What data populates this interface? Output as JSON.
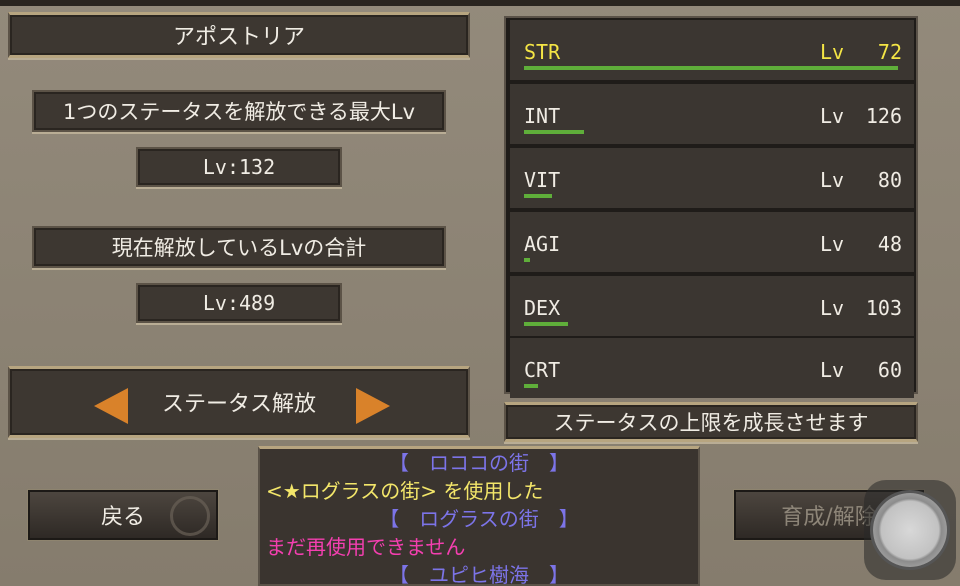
{
  "character_name": "アポストリア",
  "max_lv_label": "1つのステータスを解放できる最大Lv",
  "max_lv_value": "Lv:132",
  "total_lv_label": "現在解放しているLvの合計",
  "total_lv_value": "Lv:489",
  "mode": {
    "label": "ステータス解放",
    "prev_icon": "triangle-left-icon",
    "next_icon": "triangle-right-icon"
  },
  "stats": [
    {
      "name": "STR",
      "lv_prefix": "Lv",
      "value": "72",
      "level": 72,
      "active": true
    },
    {
      "name": "INT",
      "lv_prefix": "Lv",
      "value": "126",
      "level": 126,
      "active": false
    },
    {
      "name": "VIT",
      "lv_prefix": "Lv",
      "value": "80",
      "level": 80,
      "active": false
    },
    {
      "name": "AGI",
      "lv_prefix": "Lv",
      "value": "48",
      "level": 48,
      "active": false
    },
    {
      "name": "DEX",
      "lv_prefix": "Lv",
      "value": "103",
      "level": 103,
      "active": false
    },
    {
      "name": "CRT",
      "lv_prefix": "Lv",
      "value": "60",
      "level": 60,
      "active": false
    }
  ],
  "stat_description": "ステータスの上限を成長させます",
  "back_button": "戻る",
  "action_button": "育成/解除",
  "log": [
    {
      "type": "town",
      "text": "【　ロココの街　】"
    },
    {
      "type": "used",
      "text": "<★ログラスの街> を使用した"
    },
    {
      "type": "town",
      "text": "【　ログラスの街　】"
    },
    {
      "type": "warn",
      "text": "まだ再使用できません"
    },
    {
      "type": "town",
      "text": "【　ユピヒ樹海　】"
    }
  ],
  "colors": {
    "background": "#8a8172",
    "panel": "#3d3731",
    "active_text": "#f4e545",
    "bar": "#5fae3a",
    "town_text": "#7c74e8",
    "used_text": "#f3e66a",
    "warn_text": "#f43fb0",
    "arrow": "#d9822a"
  }
}
